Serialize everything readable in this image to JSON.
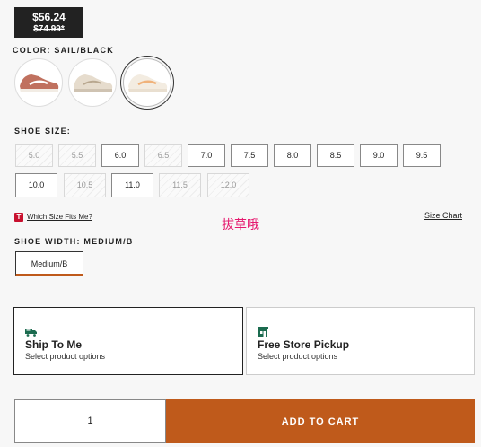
{
  "price": {
    "current": "$56.24",
    "original": "$74.99*"
  },
  "color": {
    "label": "COLOR: SAIL/BLACK"
  },
  "swatches": [
    {
      "name": "rust-brown-sneaker",
      "accent": "#c0715f"
    },
    {
      "name": "cream-tan-sneaker",
      "accent": "#d9cbb7"
    },
    {
      "name": "sail-orange-sneaker",
      "accent": "#f0b27a"
    }
  ],
  "size": {
    "label": "SHOE SIZE:",
    "options": [
      "5.0",
      "5.5",
      "6.0",
      "6.5",
      "7.0",
      "7.5",
      "8.0",
      "8.5",
      "9.0",
      "9.5",
      "10.0",
      "10.5",
      "11.0",
      "11.5",
      "12.0"
    ],
    "fit_link": "Which Size Fits Me?",
    "fit_icon": "T",
    "chart_link": "Size Chart"
  },
  "overlay_text": "拔草哦",
  "width": {
    "label": "SHOE WIDTH: MEDIUM/B",
    "option": "Medium/B"
  },
  "shipping": {
    "ship": {
      "title": "Ship To Me",
      "subtitle": "Select product options",
      "icon": "truck-icon"
    },
    "pickup": {
      "title": "Free Store Pickup",
      "subtitle": "Select product options",
      "icon": "store-icon"
    }
  },
  "cart": {
    "quantity": "1",
    "button": "ADD TO CART"
  },
  "colors": {
    "accent": "#bf5a1b",
    "dark": "#222222",
    "brand_red": "#c8102e",
    "icon_green": "#1b6b4f"
  }
}
